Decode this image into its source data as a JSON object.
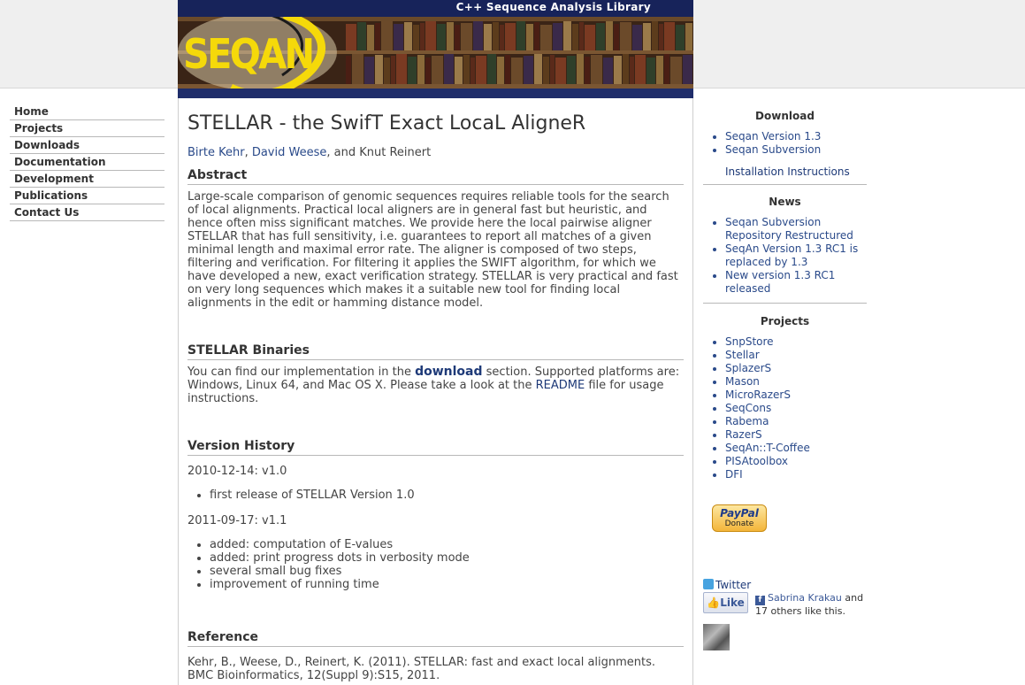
{
  "header": {
    "tagline": "C++ Sequence Analysis Library",
    "logo": "SEQAN"
  },
  "nav": {
    "items": [
      {
        "label": "Home"
      },
      {
        "label": "Projects"
      },
      {
        "label": "Downloads"
      },
      {
        "label": "Documentation"
      },
      {
        "label": "Development"
      },
      {
        "label": "Publications"
      },
      {
        "label": "Contact Us"
      }
    ]
  },
  "main": {
    "title": "STELLAR - the SwifT Exact LocaL AligneR",
    "authors": {
      "a1": "Birte Kehr",
      "sep1": ", ",
      "a2": "David Weese",
      "sep2": ", and Knut Reinert"
    },
    "abstract": {
      "heading": "Abstract",
      "text": "Large-scale comparison of genomic sequences requires reliable tools for the search of local alignments. Practical local aligners are in general fast but heuristic, and hence often miss significant matches. We provide here the local pairwise aligner STELLAR that has full sensitivity, i.e. guarantees to report all matches of a given minimal length and maximal error rate. The aligner is composed of two steps, filtering and verification. For filtering it applies the SWIFT algorithm, for which we have developed a new, exact verification strategy. STELLAR is very practical and fast on very long sequences which makes it a suitable new tool for finding local alignments in the edit or hamming distance model."
    },
    "binaries": {
      "heading": "STELLAR Binaries",
      "pre": "You can find our implementation in the ",
      "download_link": "download",
      "mid": " section. Supported platforms are: Windows, Linux 64, and Mac OS X. Please take a look at the ",
      "readme_link": "README",
      "post": " file for usage instructions."
    },
    "history": {
      "heading": "Version History",
      "v1_date": "2010-12-14: v1.0",
      "v1_items": [
        "first release of STELLAR Version 1.0"
      ],
      "v2_date": "2011-09-17: v1.1",
      "v2_items": [
        "added: computation of E-values",
        "added: print progress dots in verbosity mode",
        "several small bug fixes",
        "improvement of running time"
      ]
    },
    "reference": {
      "heading": "Reference",
      "text": "Kehr, B., Weese, D., Reinert, K. (2011). STELLAR: fast and exact local alignments. BMC Bioinformatics, 12(Suppl 9):S15, 2011."
    }
  },
  "sidebar": {
    "download": {
      "heading": "Download",
      "items": [
        "Seqan Version 1.3",
        "Seqan Subversion"
      ],
      "extra": "Installation Instructions"
    },
    "news": {
      "heading": "News",
      "items": [
        "Seqan Subversion Repository Restructured",
        "SeqAn Version 1.3 RC1 is replaced by 1.3",
        "New version 1.3 RC1 released"
      ]
    },
    "projects": {
      "heading": "Projects",
      "items": [
        "SnpStore",
        "Stellar",
        "SplazerS",
        "Mason",
        "MicroRazerS",
        "SeqCons",
        "Rabema",
        "RazerS",
        "SeqAn::T-Coffee",
        "PISAtoolbox",
        "DFI"
      ]
    },
    "paypal": {
      "brand": "PayPal",
      "label": "Donate"
    },
    "twitter": "Twitter",
    "like_label": "Like",
    "fb_name": "Sabrina Krakau",
    "fb_rest": " and 17 others like this."
  },
  "colors": {
    "link": "#2a4a8a",
    "banner_strip": "#17235a",
    "logo": "#f5d90a"
  }
}
